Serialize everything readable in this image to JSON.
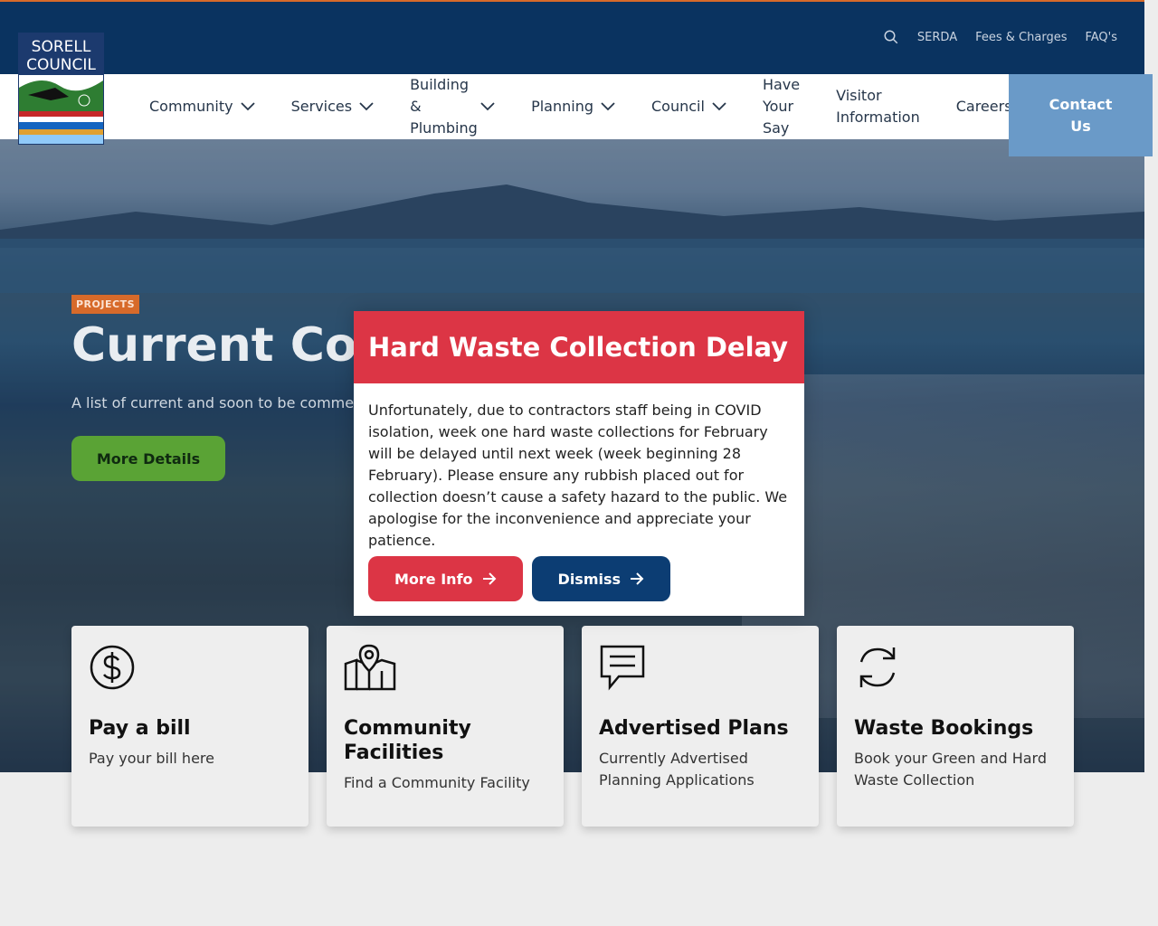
{
  "utility": {
    "links": [
      "SERDA",
      "Fees & Charges",
      "FAQ's"
    ]
  },
  "logo": {
    "line1": "SORELL",
    "line2": "COUNCIL"
  },
  "nav": {
    "community": "Community",
    "services": "Services",
    "building": [
      "Building",
      "&",
      "Plumbing"
    ],
    "planning": "Planning",
    "council": "Council",
    "have_your_say": [
      "Have",
      "Your",
      "Say"
    ],
    "visitor": [
      "Visitor",
      "Information"
    ],
    "careers": "Careers",
    "contact": "Contact Us"
  },
  "hero": {
    "tag": "PROJECTS",
    "title": "Current Council Projects",
    "subtitle": "A list of current and soon to be commenced projects",
    "button": "More Details"
  },
  "modal": {
    "title": "Hard Waste Collection Delay",
    "body": "Unfortunately, due to contractors staff being in COVID isolation, week one hard waste collections for February will be delayed until next week (week beginning 28 February). Please ensure any rubbish placed out for collection doesn’t cause a safety hazard to the public. We apologise for the inconvenience and appreciate your patience.",
    "more_info": "More Info",
    "dismiss": "Dismiss"
  },
  "cards": [
    {
      "icon": "dollar-circle-icon",
      "title": "Pay a bill",
      "desc": "Pay your bill here"
    },
    {
      "icon": "map-pin-icon",
      "title": "Community Facilities",
      "desc": "Find a Community Facility"
    },
    {
      "icon": "message-icon",
      "title": "Advertised Plans",
      "desc": "Currently Advertised Planning Applications"
    },
    {
      "icon": "refresh-icon",
      "title": "Waste Bookings",
      "desc": "Book your Green and Hard Waste Collection"
    }
  ],
  "colors": {
    "primary_navy": "#0a3360",
    "accent_orange": "#d76a2a",
    "alert_red": "#dc3545",
    "button_green": "#5aa335",
    "contact_blue": "#6a9ac8"
  }
}
